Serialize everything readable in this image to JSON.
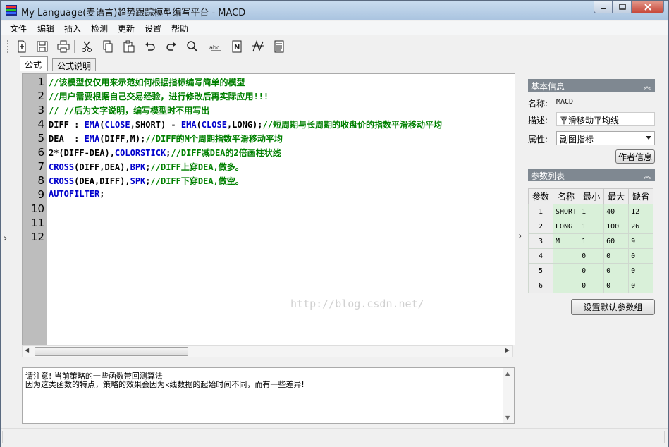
{
  "window": {
    "title": "My Language(麦语言)趋势跟踪模型编写平台 - MACD"
  },
  "menu": [
    "文件",
    "编辑",
    "插入",
    "检测",
    "更新",
    "设置",
    "帮助"
  ],
  "toolbar_icons": [
    "new-icon",
    "save-icon",
    "print-icon",
    "cut-icon",
    "copy-icon",
    "paste-icon",
    "undo-icon",
    "redo-icon",
    "find-icon",
    "spellcheck-icon",
    "n-icon",
    "formula-icon",
    "document-icon"
  ],
  "tabs": [
    "公式",
    "公式说明"
  ],
  "editor": {
    "line_numbers": [
      "1",
      "2",
      "3",
      "4",
      "5",
      "6",
      "7",
      "8",
      "9",
      "10",
      "11",
      "12"
    ],
    "watermark": "http://blog.csdn.net/",
    "lines": [
      [
        {
          "t": "//该模型仅仅用来示范如何根据指标编写简单的模型",
          "c": "cm"
        }
      ],
      [
        {
          "t": "//用户需要根据自己交易经验，进行修改后再实际应用!!!",
          "c": "cm"
        }
      ],
      [
        {
          "t": "// //后为文字说明，编写模型时不用写出",
          "c": "cm"
        }
      ],
      [
        {
          "t": "DIFF : ",
          "c": ""
        },
        {
          "t": "EMA",
          "c": "kw"
        },
        {
          "t": "(",
          "c": ""
        },
        {
          "t": "CLOSE",
          "c": "kw"
        },
        {
          "t": ",SHORT) - ",
          "c": ""
        },
        {
          "t": "EMA",
          "c": "kw"
        },
        {
          "t": "(",
          "c": ""
        },
        {
          "t": "CLOSE",
          "c": "kw"
        },
        {
          "t": ",LONG);",
          "c": ""
        },
        {
          "t": "//短周期与长周期的收盘价的指数平滑移动平均",
          "c": "cm"
        }
      ],
      [
        {
          "t": "DEA  : ",
          "c": ""
        },
        {
          "t": "EMA",
          "c": "kw"
        },
        {
          "t": "(DIFF,M);",
          "c": ""
        },
        {
          "t": "//DIFF的M个周期指数平滑移动平均",
          "c": "cm"
        }
      ],
      [
        {
          "t": "2*(DIFF-DEA),",
          "c": ""
        },
        {
          "t": "COLORSTICK",
          "c": "kw"
        },
        {
          "t": ";",
          "c": ""
        },
        {
          "t": "//DIFF减DEA的2倍画柱状线",
          "c": "cm"
        }
      ],
      [
        {
          "t": "CROSS",
          "c": "kw"
        },
        {
          "t": "(DIFF,DEA),",
          "c": ""
        },
        {
          "t": "BPK",
          "c": "kw"
        },
        {
          "t": ";",
          "c": ""
        },
        {
          "t": "//DIFF上穿DEA,做多。",
          "c": "cm"
        }
      ],
      [
        {
          "t": "CROSS",
          "c": "kw"
        },
        {
          "t": "(DEA,DIFF),",
          "c": ""
        },
        {
          "t": "SPK",
          "c": "kw"
        },
        {
          "t": ";",
          "c": ""
        },
        {
          "t": "//DIFF下穿DEA,做空。",
          "c": "cm"
        }
      ],
      [
        {
          "t": "AUTOFILTER",
          "c": "kw"
        },
        {
          "t": ";",
          "c": ""
        }
      ]
    ]
  },
  "basic_info": {
    "header": "基本信息",
    "name_label": "名称:",
    "name_value": "MACD",
    "desc_label": "描述:",
    "desc_value": "平滑移动平均线",
    "attr_label": "属性:",
    "attr_value": "副图指标",
    "author_button": "作者信息"
  },
  "params": {
    "header": "参数列表",
    "columns": [
      "参数",
      "名称",
      "最小",
      "最大",
      "缺省"
    ],
    "rows": [
      [
        "1",
        "SHORT",
        "1",
        "40",
        "12"
      ],
      [
        "2",
        "LONG",
        "1",
        "100",
        "26"
      ],
      [
        "3",
        "M",
        "1",
        "60",
        "9"
      ],
      [
        "4",
        "",
        "0",
        "0",
        "0"
      ],
      [
        "5",
        "",
        "0",
        "0",
        "0"
      ],
      [
        "6",
        "",
        "0",
        "0",
        "0"
      ]
    ],
    "default_button": "设置默认参数组"
  },
  "output": {
    "lines": [
      "请注意! 当前策略的一些函数带回测算法",
      "因为这类函数的特点，策略的效果会因为k线数据的起始时间不同，而有一些差异!"
    ]
  },
  "colors": {
    "comment": "#008000",
    "keyword": "#0000cc",
    "panel_header": "#7f8891",
    "param_cell": "#d9f0d9"
  }
}
